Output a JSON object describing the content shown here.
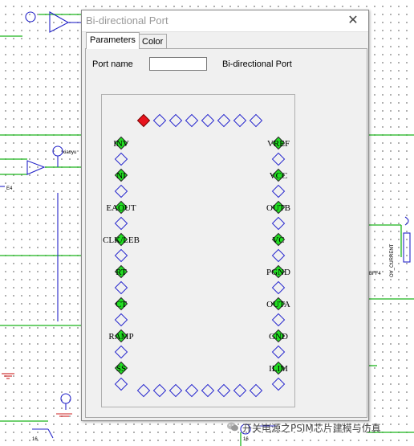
{
  "window": {
    "title": "Bi-directional Port",
    "close_symbol": "✕"
  },
  "tabs": [
    {
      "label": "Parameters",
      "active": true
    },
    {
      "label": "Color",
      "active": false
    }
  ],
  "port_name": {
    "label": "Port name",
    "value": "",
    "type_label": "Bi-directional Port"
  },
  "pins": {
    "left_labels": [
      "INV",
      "NI",
      "EAOUT",
      "CLK/LEB",
      "RT",
      "CT",
      "RAMP",
      "SS"
    ],
    "right_labels": [
      "VREF",
      "VCC",
      "OUTB",
      "VC",
      "PGND",
      "OUTA",
      "GND",
      "ILIM"
    ],
    "top_count": 8,
    "bottom_count": 8,
    "selected": "top-1",
    "colors": {
      "empty_stroke": "#2a2acf",
      "filled": "#22dd22",
      "selected": "#e8141e"
    }
  },
  "schematic": {
    "labels": [
      "xiaoyu",
      "OV_CURRENT",
      "BFF4",
      "16",
      "16",
      "E4"
    ]
  },
  "watermark": {
    "text": "开关电源之PSIM芯片建模与仿真",
    "icon": "wechat-icon"
  }
}
